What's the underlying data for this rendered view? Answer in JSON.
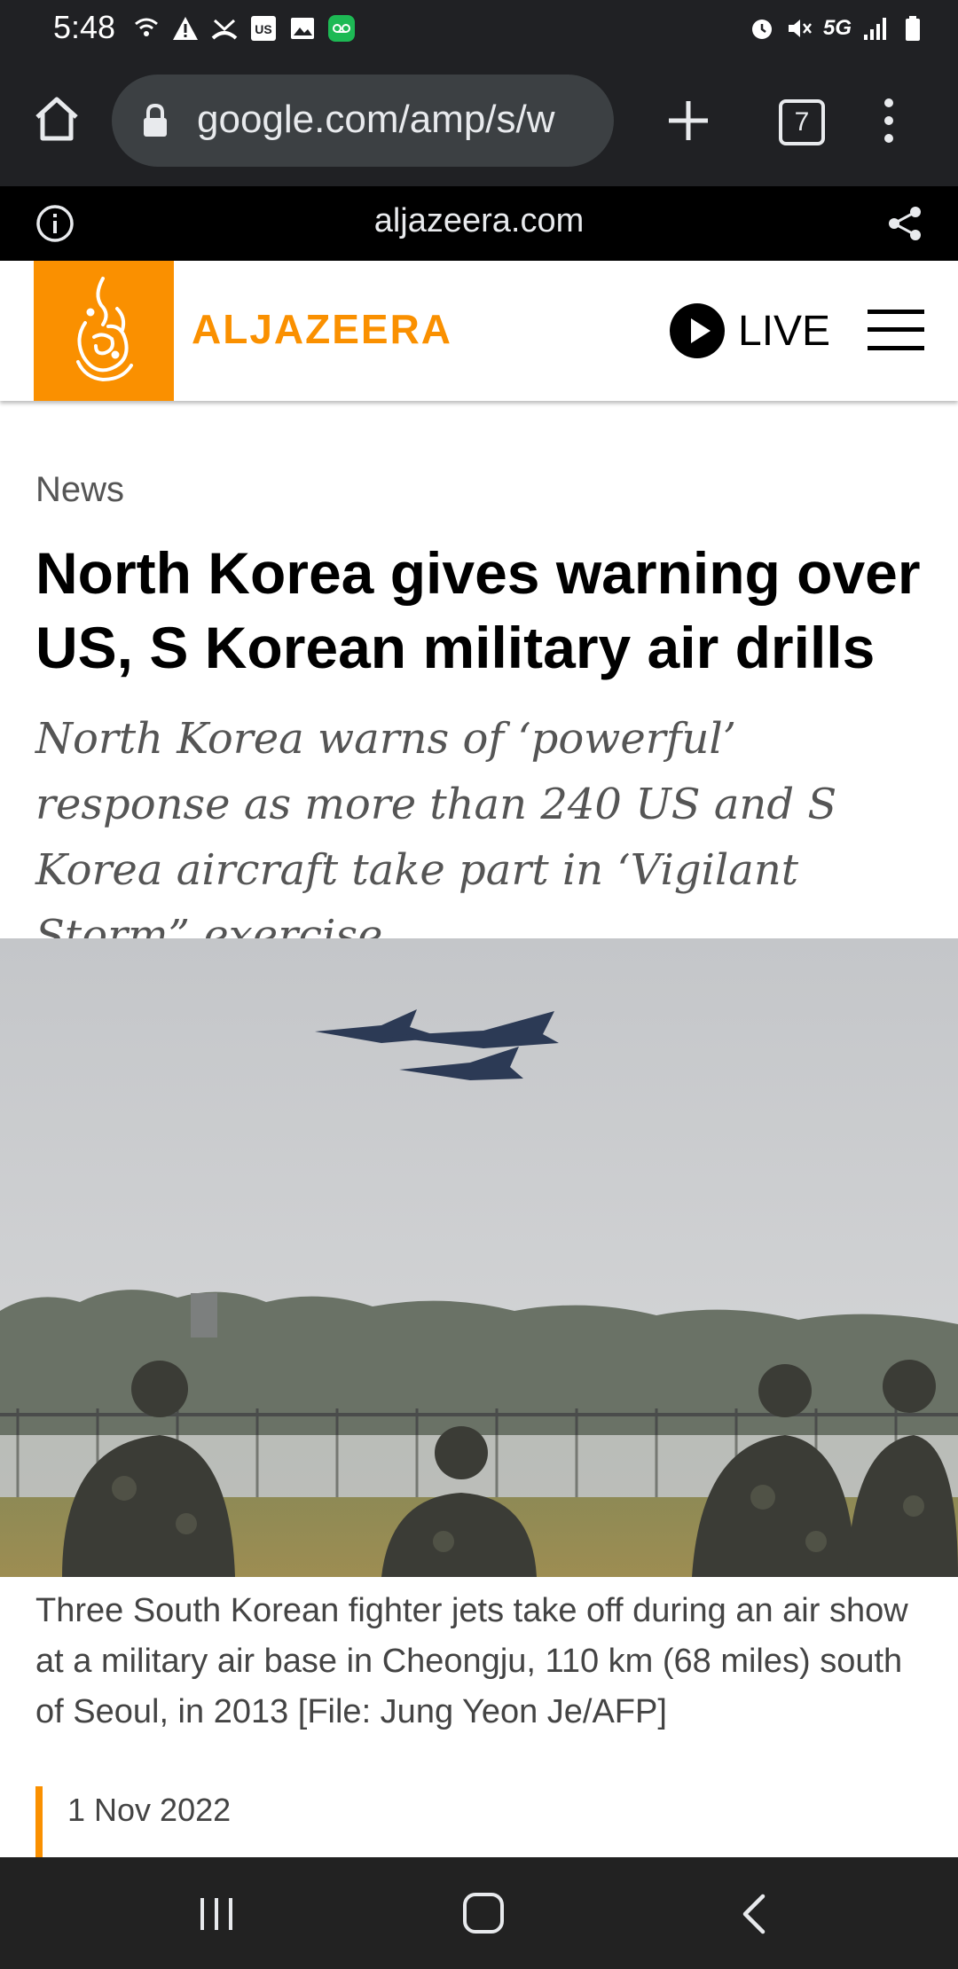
{
  "status_bar": {
    "time": "5:48",
    "network": "5G",
    "icons_left": [
      "wifi-calling-icon",
      "warning-icon",
      "missed-call-icon",
      "us-app-icon",
      "gallery-icon",
      "voicemail-icon"
    ],
    "icons_right": [
      "alarm-icon",
      "mute-icon",
      "signal-icon",
      "battery-icon"
    ]
  },
  "browser": {
    "url": "google.com/amp/s/w",
    "tab_count": "7"
  },
  "amp_bar": {
    "domain": "aljazeera.com"
  },
  "site": {
    "brand": "ALJAZEERA",
    "live_label": "LIVE",
    "accent_color": "#fa9000"
  },
  "article": {
    "category": "News",
    "headline": "North Korea gives warning over US, S Korean military air drills",
    "standfirst": "North Korea warns of ‘powerful’ response as more than 240 US and S Korea aircraft take part in ‘Vigilant Storm” exercise.",
    "caption": "Three South Korean fighter jets take off during an air show at a military air base in Cheongju, 110 km (68 miles) south of Seoul, in 2013 [File: Jung Yeon Je/AFP]",
    "date": "1 Nov 2022"
  }
}
